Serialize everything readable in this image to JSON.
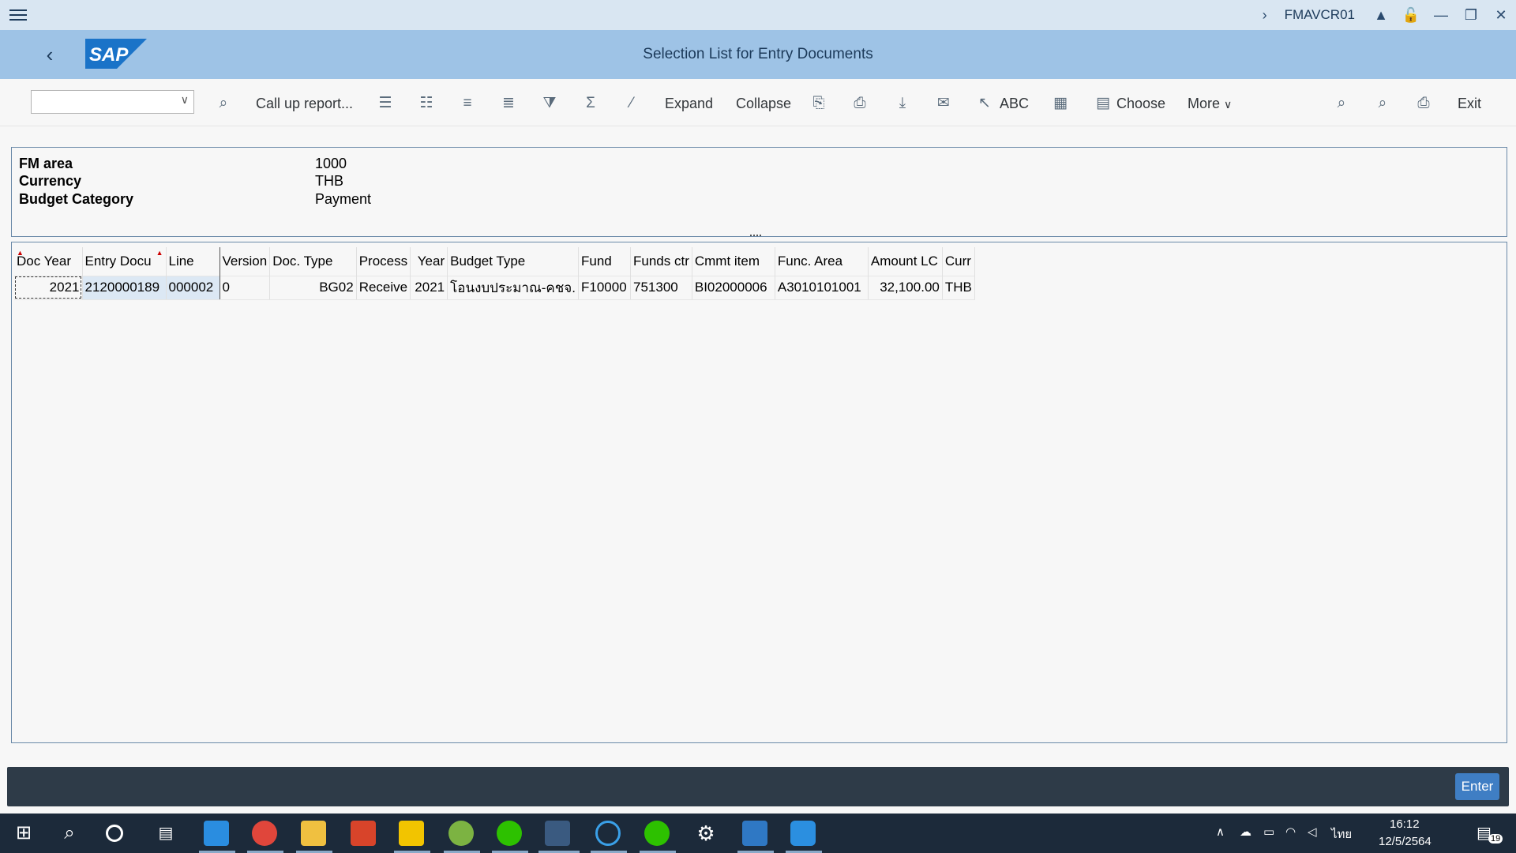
{
  "shell": {
    "tcode": "FMAVCR01"
  },
  "titlebar": {
    "title": "Selection List for Entry Documents",
    "logo_text": "SAP"
  },
  "toolbar": {
    "call_up_report": "Call up report...",
    "expand": "Expand",
    "collapse": "Collapse",
    "abc": "ABC",
    "choose": "Choose",
    "more": "More",
    "exit": "Exit"
  },
  "header": {
    "rows": [
      {
        "label": "FM area",
        "value": "1000"
      },
      {
        "label": "Currency",
        "value": "THB"
      },
      {
        "label": "Budget Category",
        "value": "Payment"
      }
    ]
  },
  "table": {
    "columns": [
      "Doc Year",
      "Entry Docu",
      "Line",
      "Version",
      "Doc. Type",
      "Process",
      "Year",
      "Budget Type",
      "Fund",
      "Funds ctr",
      "Cmmt item",
      "Func. Area",
      "Amount LC",
      "Curr"
    ],
    "rows": [
      [
        "2021",
        "2120000189",
        "000002",
        "0",
        "BG02",
        "Receive",
        "2021",
        "โอนงบประมาณ-คชจ.",
        "F10000",
        "751300",
        "BI02000006",
        "A3010101001",
        "32,100.00",
        "THB"
      ]
    ]
  },
  "footer": {
    "enter": "Enter"
  },
  "taskbar": {
    "time": "16:12",
    "date": "12/5/2564",
    "lang": "ไทย",
    "notif_count": "19"
  }
}
